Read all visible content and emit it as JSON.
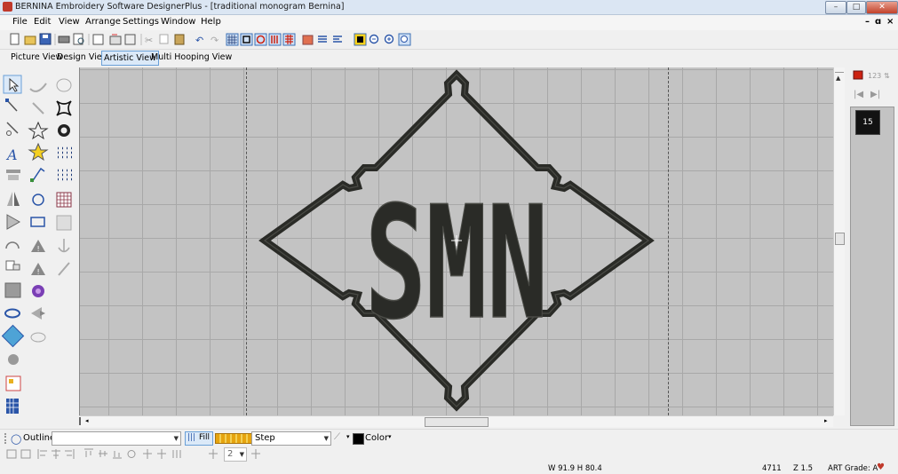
{
  "window": {
    "title": "BERNINA Embroidery Software DesignerPlus - [traditional monogram        Bernina]",
    "min_glyph": "–",
    "max_glyph": "□",
    "close_glyph": "✕",
    "child_min_glyph": "–",
    "child_restore_glyph": "ɑ",
    "child_close_glyph": "×"
  },
  "menu": {
    "file": "File",
    "edit": "Edit",
    "view": "View",
    "arrange": "Arrange",
    "settings": "Settings",
    "window": "Window",
    "help": "Help"
  },
  "views": {
    "picture": "Picture View",
    "design": "Design View",
    "artistic": "Artistic View",
    "multi": "Multi Hooping View",
    "active": "Artistic View"
  },
  "design": {
    "monogram": "SMN",
    "thread_color": "#2a2b27"
  },
  "color_panel": {
    "chip_label": "15",
    "chip_color": "#121212"
  },
  "props": {
    "outline_label": "Outline",
    "fill_label": "Fill",
    "step_label": "Step",
    "color_label": "Color",
    "spacing_value": "2"
  },
  "status": {
    "dimensions": "W  91.9 H  80.4",
    "stitches": "4711",
    "zoom": "Z 1.5",
    "grade": "ART Grade: A",
    "heart_glyph": "♥"
  },
  "colors": {
    "canvas": "#c3c3c3",
    "grid": "#a8a8a8",
    "accent": "#6aa0d8"
  }
}
